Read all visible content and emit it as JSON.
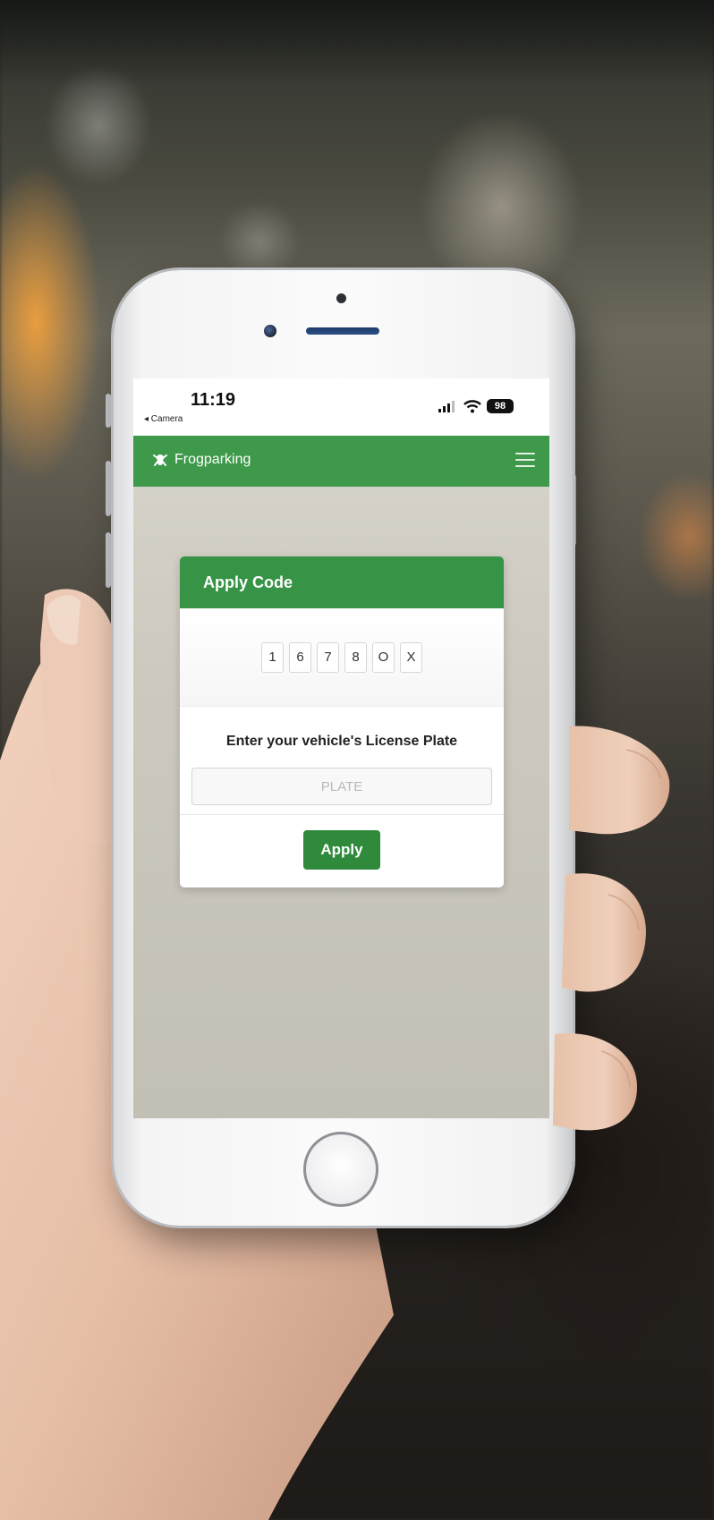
{
  "status_bar": {
    "time": "11:19",
    "back_label": "◂ Camera",
    "battery": "98"
  },
  "navbar": {
    "brand": "Frogparking"
  },
  "card": {
    "title": "Apply Code",
    "code_characters": [
      "1",
      "6",
      "7",
      "8",
      "O",
      "X"
    ],
    "plate_label": "Enter your vehicle's License Plate",
    "plate_placeholder": "PLATE",
    "apply_label": "Apply"
  },
  "colors": {
    "brand_green": "#3e9a4a",
    "header_green": "#379345",
    "button_green": "#2f8a3c"
  },
  "icons": [
    "frog-logo-icon",
    "menu-icon",
    "signal-icon",
    "wifi-icon",
    "battery-icon"
  ]
}
